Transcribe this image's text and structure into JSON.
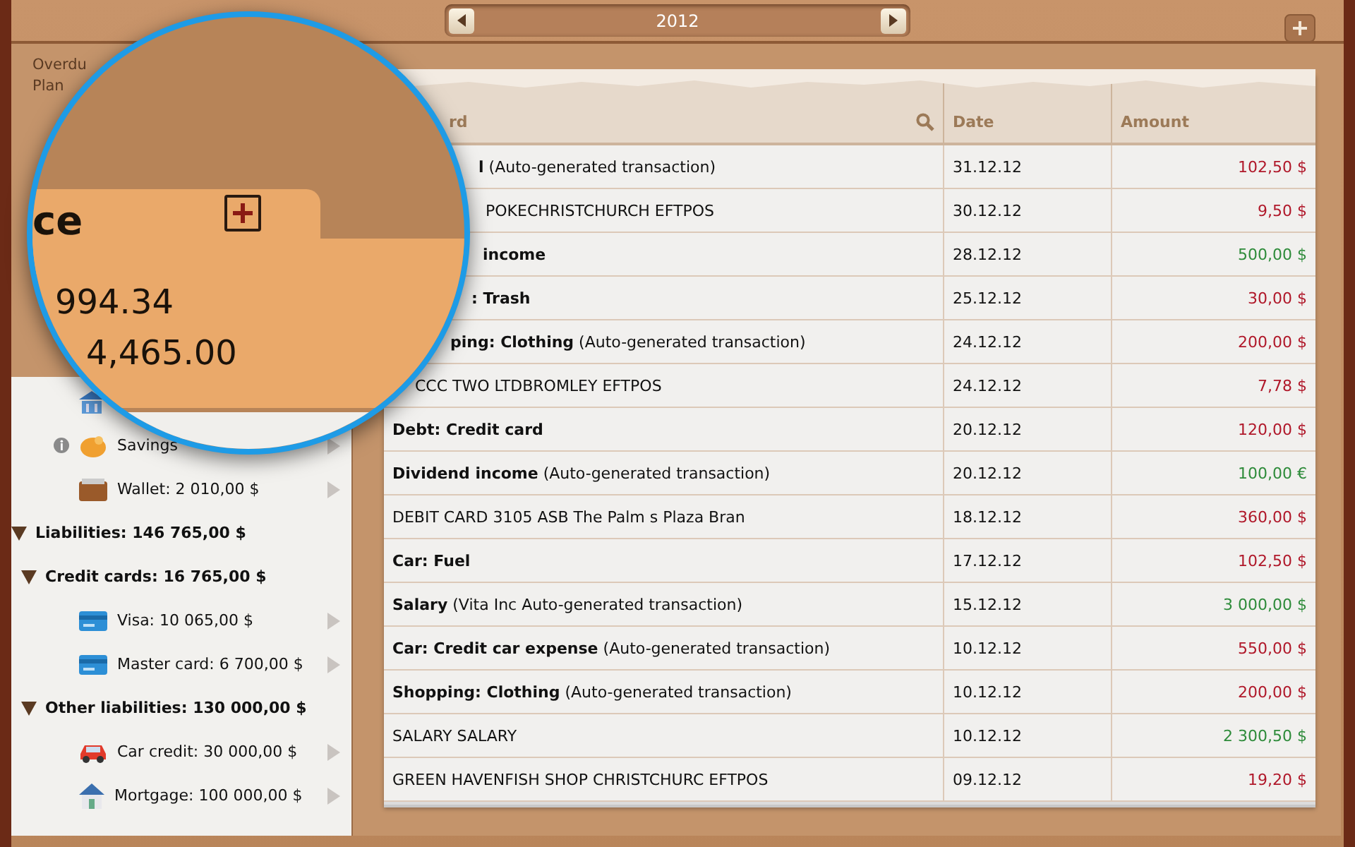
{
  "year_nav": {
    "label": "2012"
  },
  "sidebar_header": {
    "lines": [
      "Overdu",
      "Plan"
    ]
  },
  "magnifier": {
    "title": "ce",
    "lines": [
      "994.34",
      "4,465.00"
    ]
  },
  "accounts": [
    {
      "children": [
        {
          "children": [
            {
              "kind": "bank"
            },
            {
              "kind": "savings",
              "label": "Savings",
              "info": true
            },
            {
              "kind": "wallet",
              "label": "Wallet: 2 010,00 $"
            }
          ]
        }
      ]
    },
    {
      "label": "Liabilities: 146 765,00 $",
      "expanded": true,
      "children": [
        {
          "label": "Credit cards: 16 765,00 $",
          "expanded": true,
          "children": [
            {
              "kind": "card",
              "label": "Visa: 10 065,00 $"
            },
            {
              "kind": "card",
              "label": "Master card: 6 700,00 $"
            }
          ]
        },
        {
          "label": "Other liabilities: 130 000,00 $",
          "expanded": true,
          "children": [
            {
              "kind": "car",
              "label": "Car credit: 30 000,00 $"
            },
            {
              "kind": "house",
              "label": "Mortgage: 100 000,00 $"
            }
          ]
        }
      ]
    }
  ],
  "table": {
    "columns": [
      "rd",
      "Date",
      "Amount"
    ],
    "rows": [
      {
        "category": "l",
        "note": "(Auto-generated transaction)",
        "date": "31.12.12",
        "amount": "102,50 $",
        "income": false
      },
      {
        "text": "POKECHRISTCHURCH EFTPOS",
        "date": "30.12.12",
        "amount": "9,50 $",
        "income": false
      },
      {
        "category": "income",
        "date": "28.12.12",
        "amount": "500,00 $",
        "income": true
      },
      {
        "category": ": Trash",
        "date": "25.12.12",
        "amount": "30,00 $",
        "income": false
      },
      {
        "category": "ping: Clothing",
        "note": "(Auto-generated transaction)",
        "date": "24.12.12",
        "amount": "200,00 $",
        "income": false
      },
      {
        "text": "CCC TWO LTDBROMLEY EFTPOS",
        "date": "24.12.12",
        "amount": "7,78 $",
        "income": false
      },
      {
        "category": "Debt: Credit card",
        "date": "20.12.12",
        "amount": "120,00 $",
        "income": false
      },
      {
        "category": "Dividend income",
        "note": "(Auto-generated transaction)",
        "date": "20.12.12",
        "amount": "100,00 €",
        "income": true
      },
      {
        "text": "DEBIT CARD 3105 ASB The Palm s Plaza Bran",
        "date": "18.12.12",
        "amount": "360,00 $",
        "income": false
      },
      {
        "category": "Car: Fuel",
        "date": "17.12.12",
        "amount": "102,50 $",
        "income": false
      },
      {
        "category": "Salary",
        "note": "(Vita Inc Auto-generated transaction)",
        "date": "15.12.12",
        "amount": "3 000,00 $",
        "income": true
      },
      {
        "category": "Car: Credit car expense",
        "note": "(Auto-generated transaction)",
        "date": "10.12.12",
        "amount": "550,00 $",
        "income": false
      },
      {
        "category": "Shopping: Clothing",
        "note": "(Auto-generated transaction)",
        "date": "10.12.12",
        "amount": "200,00 $",
        "income": false
      },
      {
        "text": "SALARY SALARY",
        "date": "10.12.12",
        "amount": "2 300,50 $",
        "income": true
      },
      {
        "text": "GREEN HAVENFISH SHOP CHRISTCHURC EFTPOS",
        "date": "09.12.12",
        "amount": "19,20 $",
        "income": false
      }
    ]
  }
}
